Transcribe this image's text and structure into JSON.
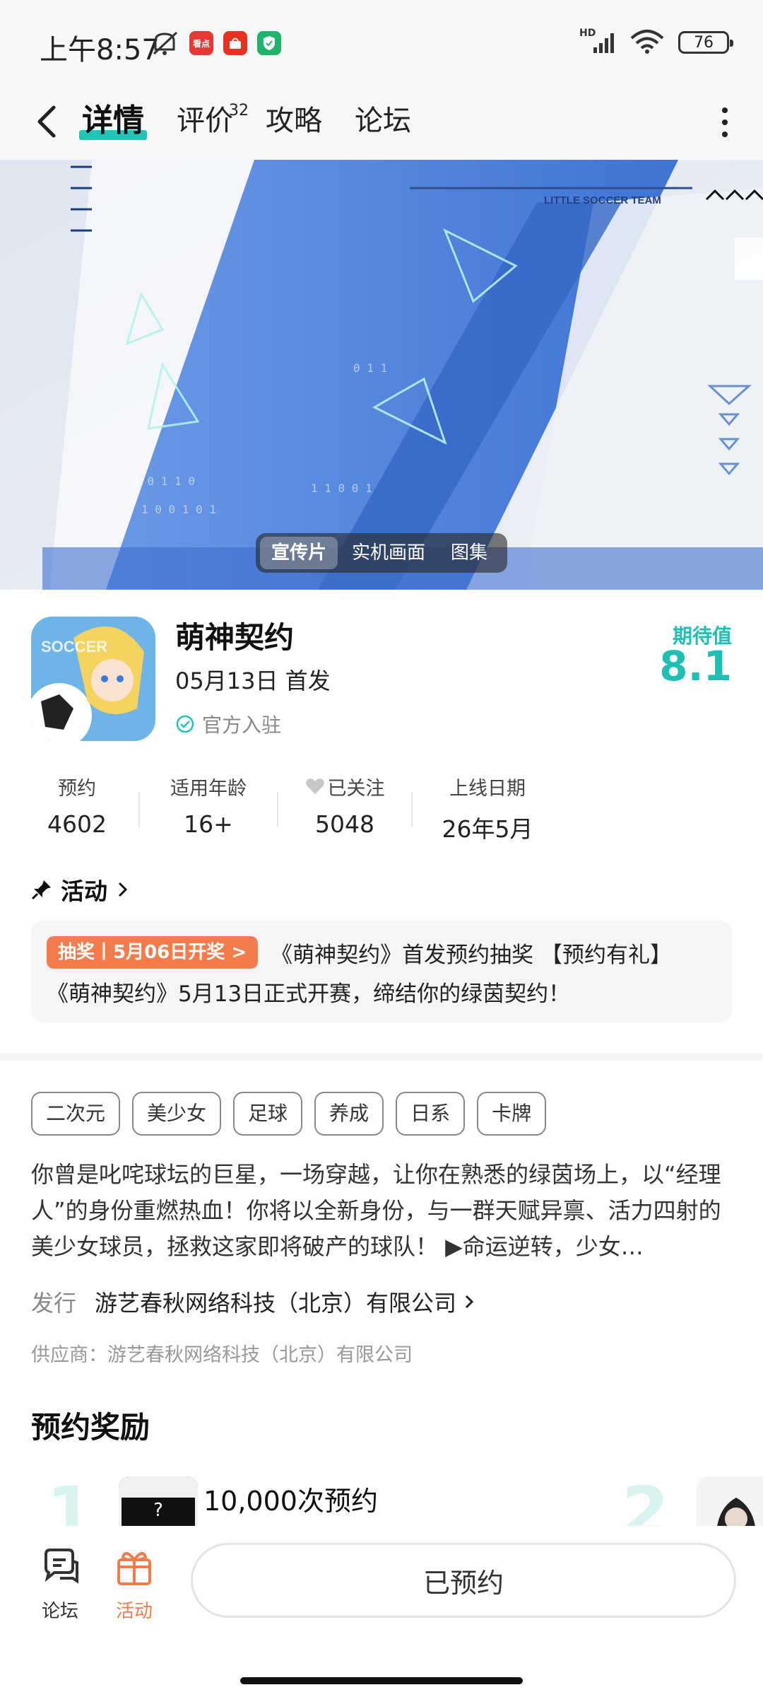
{
  "status_bar": {
    "time": "上午8:57",
    "battery": "76",
    "network": "HD",
    "app_badge_labels": [
      "看点",
      "",
      ""
    ]
  },
  "nav": {
    "tabs": [
      {
        "label": "详情",
        "badge": ""
      },
      {
        "label": "评价",
        "badge": "32"
      },
      {
        "label": "攻略",
        "badge": ""
      },
      {
        "label": "论坛",
        "badge": ""
      }
    ],
    "active_tab": "详情"
  },
  "banner": {
    "watermark_text": "LITTLE SOCCER TEAM",
    "media_options": [
      "宣传片",
      "实机画面",
      "图集"
    ],
    "active_media": "宣传片"
  },
  "game": {
    "name": "萌神契约",
    "release": "05月13日 首发",
    "official": "官方入驻",
    "expect_label": "期待值",
    "expect_value": "8.1"
  },
  "stats": [
    {
      "label": "预约",
      "value": "4602"
    },
    {
      "label": "适用年龄",
      "value": "16+"
    },
    {
      "label": "已关注",
      "value": "5048"
    },
    {
      "label": "上线日期",
      "value": "26年5月"
    }
  ],
  "activity": {
    "header": "活动",
    "tag": "抽奖丨5月06日开奖 >",
    "line1": "《萌神契约》首发预约抽奖 【预约有礼】",
    "line2": "《萌神契约》5月13日正式开赛，缔结你的绿茵契约！"
  },
  "tags": [
    "二次元",
    "美少女",
    "足球",
    "养成",
    "日系",
    "卡牌"
  ],
  "description": "你曾是叱咤球坛的巨星，一场穿越，让你在熟悉的绿茵场上，以“经理人”的身份重燃热血！你将以全新身份，与一群天赋异禀、活力四射的美少女球员，拯救这家即将破产的球队！ ▶命运逆转，少女…",
  "publisher": {
    "key": "发行",
    "value": "游艺春秋网络科技（北京）有限公司"
  },
  "supplier": "供应商：游艺春秋网络科技（北京）有限公司",
  "rewards": {
    "title": "预约奖励",
    "items": [
      {
        "num": "1",
        "text": "10,000次预约"
      },
      {
        "num": "2",
        "text": ""
      }
    ]
  },
  "bottom": {
    "forum": "论坛",
    "activity": "活动",
    "reserve": "已预约"
  },
  "colors": {
    "accent_teal": "#1fbfb3",
    "activity_orange": "#f47b4b",
    "banner_blue": "#4a7fd6"
  }
}
